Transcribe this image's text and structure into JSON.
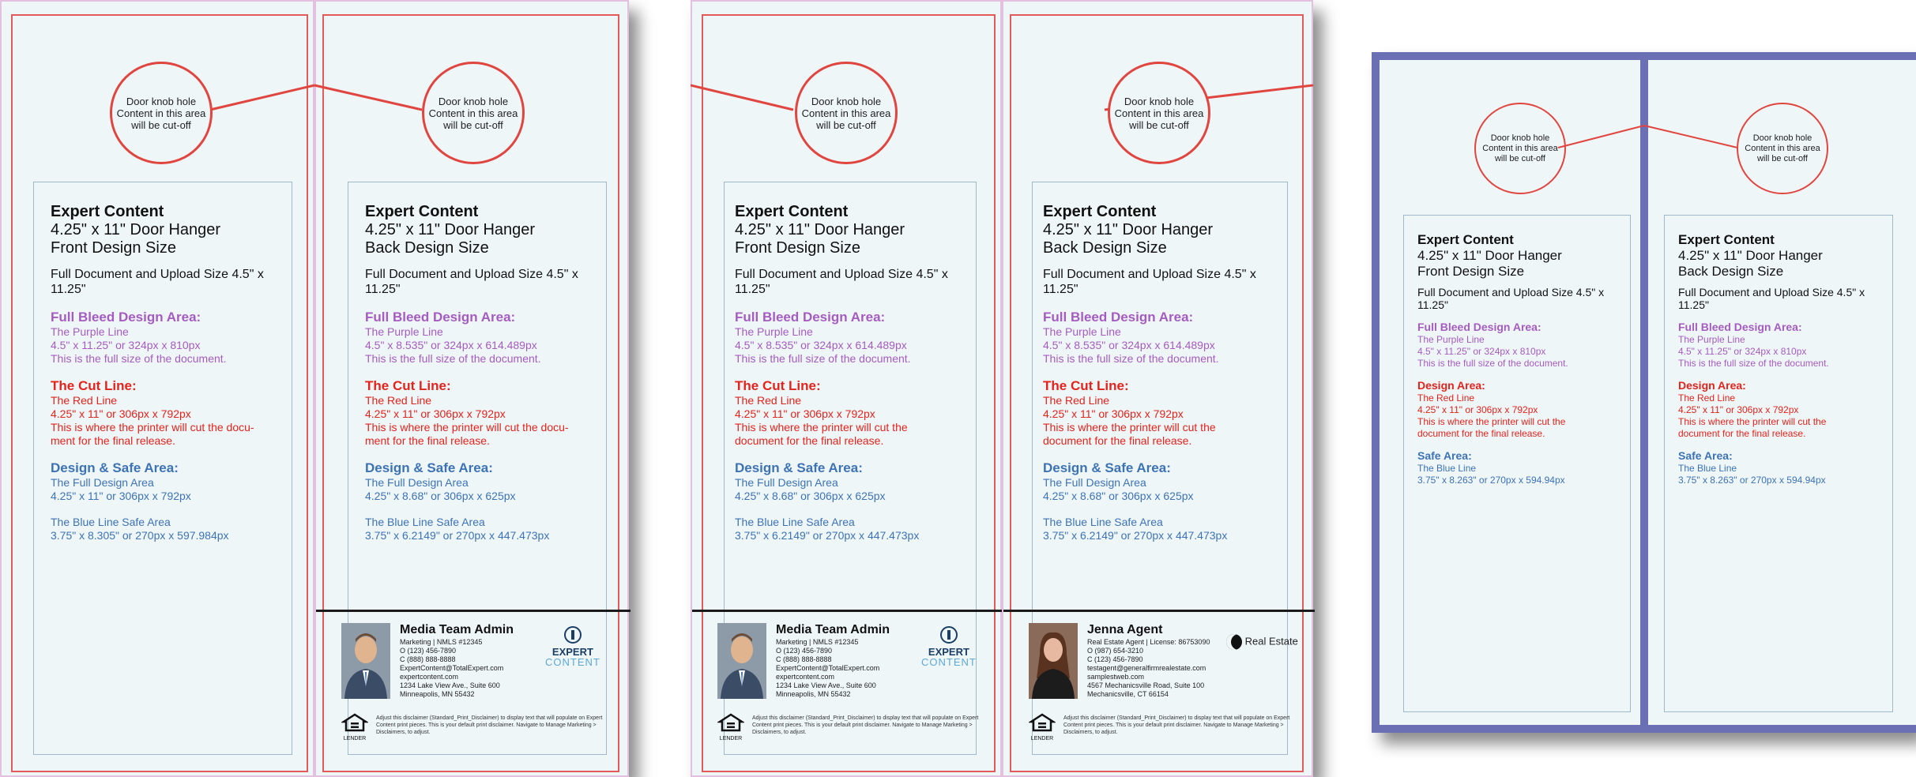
{
  "circle_text": "Door knob hole\nContent in this area\nwill be cut-off",
  "panels": [
    {
      "title": "Expert Content",
      "subtitle": "4.25\" x 11\" Door Hanger",
      "side": "Front Design Size",
      "doc": "Full Document and Upload Size 4.5\" x 11.25\"",
      "sections": [
        {
          "color": "purple",
          "heading": "Full Bleed Design Area:",
          "lines": [
            "The Purple Line",
            "4.5\" x 11.25\" or 324px x 810px",
            "This is the full size of the document."
          ]
        },
        {
          "color": "red",
          "heading": "The Cut Line:",
          "lines": [
            "The Red Line",
            "4.25\" x 11\" or 306px x 792px",
            "This is where the printer will cut the docu-",
            "ment for the final release."
          ]
        },
        {
          "color": "blue",
          "heading": "Design & Safe Area:",
          "lines": [
            "The Full Design Area",
            "4.25\" x 11\" or 306px x 792px"
          ]
        },
        {
          "color": "blue",
          "heading": "",
          "lines": [
            "The Blue Line Safe Area",
            "3.75\" x 8.305\" or 270px x 597.984px"
          ]
        }
      ]
    },
    {
      "title": "Expert Content",
      "subtitle": "4.25\" x 11\" Door Hanger",
      "side": "Back Design Size",
      "doc": "Full Document and Upload Size 4.5\" x 11.25\"",
      "sections": [
        {
          "color": "purple",
          "heading": "Full Bleed Design Area:",
          "lines": [
            "The Purple Line",
            "4.5\" x 8.535\" or 324px x 614.489px",
            "This is the full size of the document."
          ]
        },
        {
          "color": "red",
          "heading": "The Cut Line:",
          "lines": [
            "The Red Line",
            "4.25\" x 11\" or 306px x 792px",
            "This is where the printer will cut the docu-",
            "ment for the final release."
          ]
        },
        {
          "color": "blue",
          "heading": "Design & Safe Area:",
          "lines": [
            "The Full Design Area",
            "4.25\" x 8.68\" or 306px x 625px"
          ]
        },
        {
          "color": "blue",
          "heading": "",
          "lines": [
            "The Blue Line Safe Area",
            "3.75\" x 6.2149\" or 270px x 447.473px"
          ]
        }
      ]
    },
    {
      "title": "Expert Content",
      "subtitle": "4.25\" x 11\" Door Hanger",
      "side": "Front Design Size",
      "doc": "Full Document and Upload Size 4.5\" x 11.25\"",
      "sections": [
        {
          "color": "purple",
          "heading": "Full Bleed Design Area:",
          "lines": [
            "The Purple Line",
            "4.5\" x 8.535\" or 324px x 614.489px",
            "This is the full size of the document."
          ]
        },
        {
          "color": "red",
          "heading": "The Cut Line:",
          "lines": [
            "The Red Line",
            "4.25\" x 11\" or 306px x 792px",
            "This is where the printer will cut the",
            "document for the final release."
          ]
        },
        {
          "color": "blue",
          "heading": "Design & Safe Area:",
          "lines": [
            "The Full Design Area",
            "4.25\" x 8.68\" or 306px x 625px"
          ]
        },
        {
          "color": "blue",
          "heading": "",
          "lines": [
            "The Blue Line Safe Area",
            "3.75\" x 6.2149\" or 270px x 447.473px"
          ]
        }
      ]
    },
    {
      "title": "Expert Content",
      "subtitle": "4.25\" x 11\" Door Hanger",
      "side": "Back Design Size",
      "doc": "Full Document and Upload Size 4.5\" x 11.25\"",
      "sections": [
        {
          "color": "purple",
          "heading": "Full Bleed Design Area:",
          "lines": [
            "The Purple Line",
            "4.5\" x 8.535\" or 324px x 614.489px",
            "This is the full size of the document."
          ]
        },
        {
          "color": "red",
          "heading": "The Cut Line:",
          "lines": [
            "The Red Line",
            "4.25\" x 11\" or 306px x 792px",
            "This is where the printer will cut the",
            "document for the final release."
          ]
        },
        {
          "color": "blue",
          "heading": "Design & Safe Area:",
          "lines": [
            "The Full Design Area",
            "4.25\" x 8.68\" or 306px x 625px"
          ]
        },
        {
          "color": "blue",
          "heading": "",
          "lines": [
            "The Blue Line Safe Area",
            "3.75\" x 6.2149\" or 270px x 447.473px"
          ]
        }
      ]
    },
    {
      "title": "Expert Content",
      "subtitle": "4.25\" x 11\" Door Hanger",
      "side": "Front Design Size",
      "doc": "Full Document and Upload Size 4.5\" x 11.25\"",
      "sections": [
        {
          "color": "purple",
          "heading": "Full Bleed Design Area:",
          "lines": [
            "The Purple Line",
            "4.5\" x 11.25\" or 324px x 810px",
            "This is the full size of the document."
          ]
        },
        {
          "color": "red",
          "heading": "Design Area:",
          "lines": [
            "The Red Line",
            "4.25\" x 11\" or 306px x 792px",
            "This is where the printer will cut the",
            "document for the final release."
          ]
        },
        {
          "color": "blue",
          "heading": "Safe Area:",
          "lines": [
            "The Blue Line",
            "3.75\" x 8.263\" or 270px x 594.94px"
          ]
        }
      ]
    },
    {
      "title": "Expert Content",
      "subtitle": "4.25\" x 11\" Door Hanger",
      "side": "Back Design Size",
      "doc": "Full Document and Upload Size 4.5\" x 11.25\"",
      "sections": [
        {
          "color": "purple",
          "heading": "Full Bleed Design Area:",
          "lines": [
            "The Purple Line",
            "4.5\" x 11.25\" or 324px x 810px",
            "This is the full size of the document."
          ]
        },
        {
          "color": "red",
          "heading": "Design Area:",
          "lines": [
            "The Red Line",
            "4.25\" x 11\" or 306px x 792px",
            "This is where the printer will cut the",
            "document for the final release."
          ]
        },
        {
          "color": "blue",
          "heading": "Safe Area:",
          "lines": [
            "The Blue Line",
            "3.75\" x 8.263\" or 270px x 594.94px"
          ]
        }
      ]
    }
  ],
  "footers": [
    {
      "name": "Media Team Admin",
      "lines": [
        "Marketing | NMLS #12345",
        "O (123) 456-7890",
        "C (888) 888-8888",
        "ExpertContent@TotalExpert.com",
        "expertcontent.com",
        "1234 Lake View Ave., Suite 600",
        "Minneapolis, MN 55432"
      ],
      "logo_main": "EXPERT",
      "logo_sub": "CONTENT",
      "ehl_label": "LENDER",
      "disclaimer": "Adjust this disclaimer (Standard_Print_Disclaimer) to display text that will populate on Expert Content print pieces. This is your default print disclaimer. Navigate to Manage Marketing > Disclaimers, to adjust."
    },
    {
      "name": "Media Team Admin",
      "lines": [
        "Marketing | NMLS #12345",
        "O (123) 456-7890",
        "C (888) 888-8888",
        "ExpertContent@TotalExpert.com",
        "expertcontent.com",
        "1234 Lake View Ave., Suite 600",
        "Minneapolis, MN 55432"
      ],
      "logo_main": "EXPERT",
      "logo_sub": "CONTENT",
      "ehl_label": "LENDER",
      "disclaimer": "Adjust this disclaimer (Standard_Print_Disclaimer) to display text that will populate on Expert Content print pieces. This is your default print disclaimer. Navigate to Manage Marketing > Disclaimers, to adjust."
    },
    {
      "name": "Jenna Agent",
      "lines": [
        "Real Estate Agent | License: 86753090",
        "O (987) 654-3210",
        "C (123) 456-7890",
        "testagent@generalfirmrealestate.com",
        "samplestweb.com",
        "4567 Mechanicsville Road, Suite 100",
        "Mechanicsville, CT 66154"
      ],
      "logo_main": "Real Estate",
      "logo_sub": "",
      "ehl_label": "LENDER",
      "disclaimer": "Adjust this disclaimer (Standard_Print_Disclaimer) to display text that will populate on Expert Content print pieces. This is your default print disclaimer. Navigate to Manage Marketing > Disclaimers, to adjust."
    }
  ],
  "colors": {
    "purple": "#a55cc0",
    "red": "#e3231c",
    "blue": "#3d73b5",
    "frame_blue": "#6b6fb3",
    "panel_bg": "#eef6f8"
  }
}
